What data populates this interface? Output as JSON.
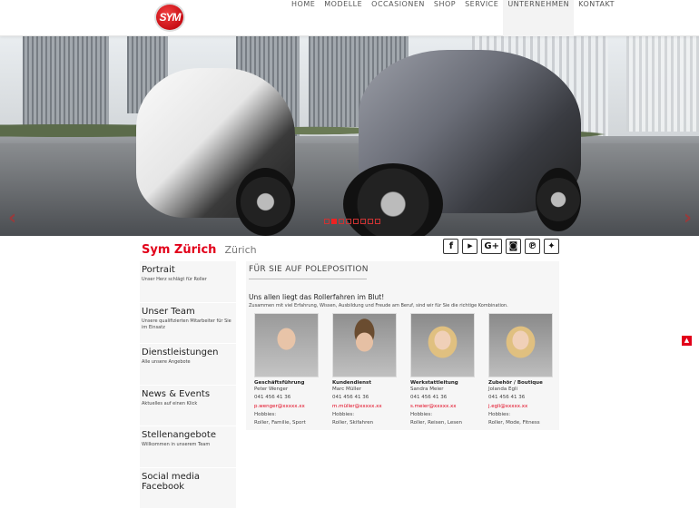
{
  "brand": {
    "logo_text": "SYM",
    "accent": "#e2001a"
  },
  "nav": {
    "items": [
      {
        "label": "HOME"
      },
      {
        "label": "MODELLE"
      },
      {
        "label": "OCCASIONEN"
      },
      {
        "label": "SHOP"
      },
      {
        "label": "SERVICE"
      },
      {
        "label": "UNTERNEHMEN",
        "active": true
      },
      {
        "label": "KONTAKT"
      }
    ]
  },
  "slider": {
    "prev_icon": "chevron-left-icon",
    "next_icon": "chevron-right-icon",
    "prev_glyph": "‹",
    "next_glyph": "›",
    "slide_count": 8,
    "active_slide": 2
  },
  "page": {
    "title": "Sym Zürich",
    "subtitle": "Zürich"
  },
  "social": [
    {
      "name": "facebook",
      "glyph": "f"
    },
    {
      "name": "youtube",
      "glyph": "▶"
    },
    {
      "name": "google-plus",
      "glyph": "G+"
    },
    {
      "name": "instagram",
      "glyph": "◙"
    },
    {
      "name": "pinterest",
      "glyph": "℗"
    },
    {
      "name": "twitter",
      "glyph": "✦"
    }
  ],
  "sidebar": {
    "items": [
      {
        "title": "Portrait",
        "desc": "Unser Herz schlägt für Roller"
      },
      {
        "title": "Unser Team",
        "desc": "Unsere qualifizierten Mitarbeiter für Sie im Einsatz"
      },
      {
        "title": "Dienstleistungen",
        "desc": "Alle unsere Angebote"
      },
      {
        "title": "News & Events",
        "desc": "Aktuelles auf einen Klick"
      },
      {
        "title": "Stellenangebote",
        "desc": "Willkommen in unserem Team"
      },
      {
        "title": "Social media Facebook",
        "desc": ""
      }
    ]
  },
  "content": {
    "heading": "FÜR SIE AUF POLEPOSITION",
    "lead": "Uns allen liegt das Rollerfahren im Blut!",
    "sub": "Zusammen mit viel Erfahrung, Wissen, Ausbildung und Freude am Beruf, sind wir für Sie die richtige Kombination.",
    "team": [
      {
        "role": "Geschäftsführung",
        "name": "Peter Wenger",
        "phone": "041 456 41 36",
        "email": "p.wenger@xxxxx.xx",
        "hobbies_label": "Hobbies:",
        "hobbies": "Roller, Familie, Sport"
      },
      {
        "role": "Kundendienst",
        "name": "Marc Müller",
        "phone": "041 456 41 36",
        "email": "m.müller@xxxxx.xx",
        "hobbies_label": "Hobbies:",
        "hobbies": "Roller, Skifahren"
      },
      {
        "role": "Werkstattleitung",
        "name": "Sandra Meier",
        "phone": "041 456 41 36",
        "email": "s.meier@xxxxx.xx",
        "hobbies_label": "Hobbies:",
        "hobbies": "Roller, Reisen, Lesen"
      },
      {
        "role": "Zubehör / Boutique",
        "name": "Jolanda Egli",
        "phone": "041 456 41 36",
        "email": "j.egli@xxxxx.xx",
        "hobbies_label": "Hobbies:",
        "hobbies": "Roller, Mode, Fitness"
      }
    ]
  },
  "back_to_top": {
    "glyph": "▲",
    "icon": "arrow-up-icon"
  }
}
